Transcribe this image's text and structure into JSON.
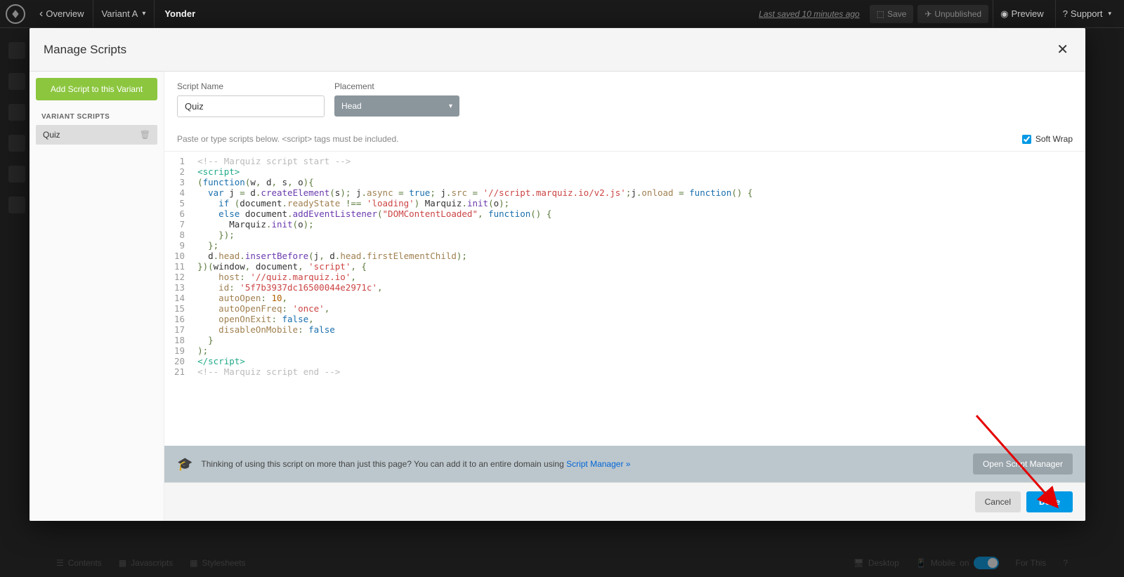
{
  "topbar": {
    "overview": "Overview",
    "variant": "Variant A",
    "title": "Yonder",
    "last_saved": "Last saved  10 minutes ago",
    "save": "Save",
    "unpublished": "Unpublished",
    "preview": "Preview",
    "support": "Support"
  },
  "bg_bottom": {
    "contents": "Contents",
    "javascripts": "Javascripts",
    "stylesheets": "Stylesheets",
    "desktop": "Desktop",
    "mobile": "Mobile",
    "mobile_toggle": "on",
    "for_this": "For This"
  },
  "modal": {
    "title": "Manage Scripts",
    "add_button": "Add Script to this Variant",
    "section": "VARIANT SCRIPTS",
    "scripts": [
      {
        "name": "Quiz"
      }
    ],
    "form": {
      "name_label": "Script Name",
      "name_value": "Quiz",
      "placement_label": "Placement",
      "placement_value": "Head"
    },
    "hint": "Paste or type scripts below. <script> tags must be included.",
    "softwrap_label": "Soft Wrap",
    "softwrap_checked": true,
    "info_text": "Thinking of using this script on more than just this page? You can add it to an entire domain using ",
    "info_link": "Script Manager »",
    "open_sm": "Open Script Manager",
    "cancel": "Cancel",
    "done": "Done"
  },
  "code": {
    "lines": 21,
    "l1": "<!-- Marquiz script start -->",
    "l21": "<!-- Marquiz script end -->",
    "url_v2": "'//script.marquiz.io/v2.js'",
    "str_loading": "'loading'",
    "str_dcl": "\"DOMContentLoaded\"",
    "str_script": "'script'",
    "host": "'//quiz.marquiz.io'",
    "id": "'5f7b3937dc16500044e2971c'",
    "autoOpen": "10",
    "autoOpenFreq": "'once'"
  }
}
